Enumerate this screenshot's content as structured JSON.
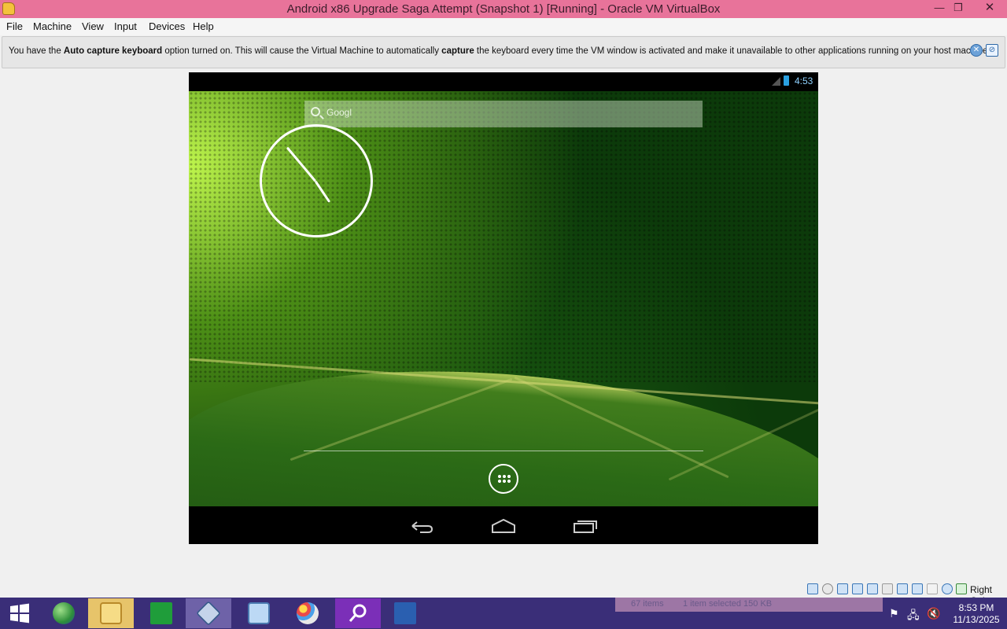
{
  "window": {
    "title": "Android x86 Upgrade Saga Attempt (Snapshot 1) [Running] - Oracle VM VirtualBox",
    "minimize": "—",
    "maximize": "❐",
    "close": "✕"
  },
  "menu": {
    "items": [
      "File",
      "Machine",
      "View",
      "Input",
      "Devices",
      "Help"
    ]
  },
  "notice": {
    "part1": "You have the ",
    "bold1": "Auto capture keyboard",
    "part2": " option turned on. This will cause the Virtual Machine to automatically ",
    "bold2": "capture",
    "part3": " the keyboard every time the VM window is activated and make it unavailable to other applications running on your host machine:"
  },
  "android": {
    "status_time": "4:53",
    "search_label": "Googl",
    "icons": [
      "signal-icon",
      "battery-icon",
      "search-icon",
      "analog-clock",
      "app-drawer-icon",
      "back-icon",
      "home-icon",
      "recent-apps-icon"
    ]
  },
  "vm_status": {
    "host_key": "Right Ctrl"
  },
  "taskbar": {
    "explorer_ghost": {
      "items": "67 items",
      "selected": "1 item selected  150 KB"
    },
    "clock_time": "8:53 PM",
    "clock_date": "11/13/2025"
  },
  "colors": {
    "titlebar": "#e8739a",
    "taskbar": "#3a2e78",
    "android_accent": "#2aa0e0"
  }
}
